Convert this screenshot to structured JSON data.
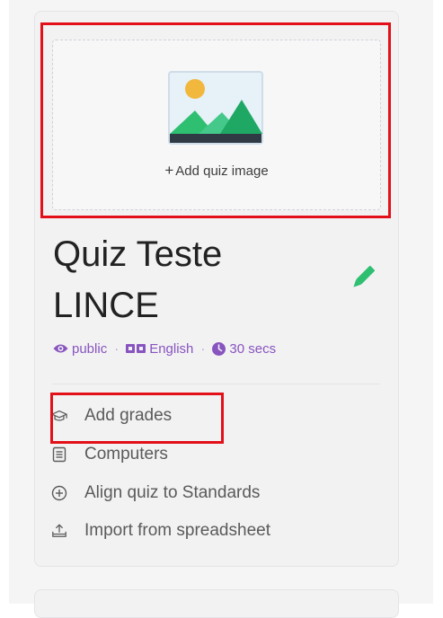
{
  "image_upload": {
    "label": "Add quiz image",
    "plus": "+"
  },
  "quiz": {
    "title": "Quiz Teste LINCE",
    "visibility": "public",
    "language": "English",
    "time": "30 secs"
  },
  "separator": "·",
  "actions": [
    {
      "label": "Add grades",
      "icon": "graduation-cap-icon"
    },
    {
      "label": "Computers",
      "icon": "book-icon"
    },
    {
      "label": "Align quiz to Standards",
      "icon": "plus-circle-icon"
    },
    {
      "label": "Import from spreadsheet",
      "icon": "upload-icon"
    }
  ],
  "colors": {
    "accent": "#8854c0",
    "edit": "#2fbf71",
    "highlight": "#e3101a"
  }
}
